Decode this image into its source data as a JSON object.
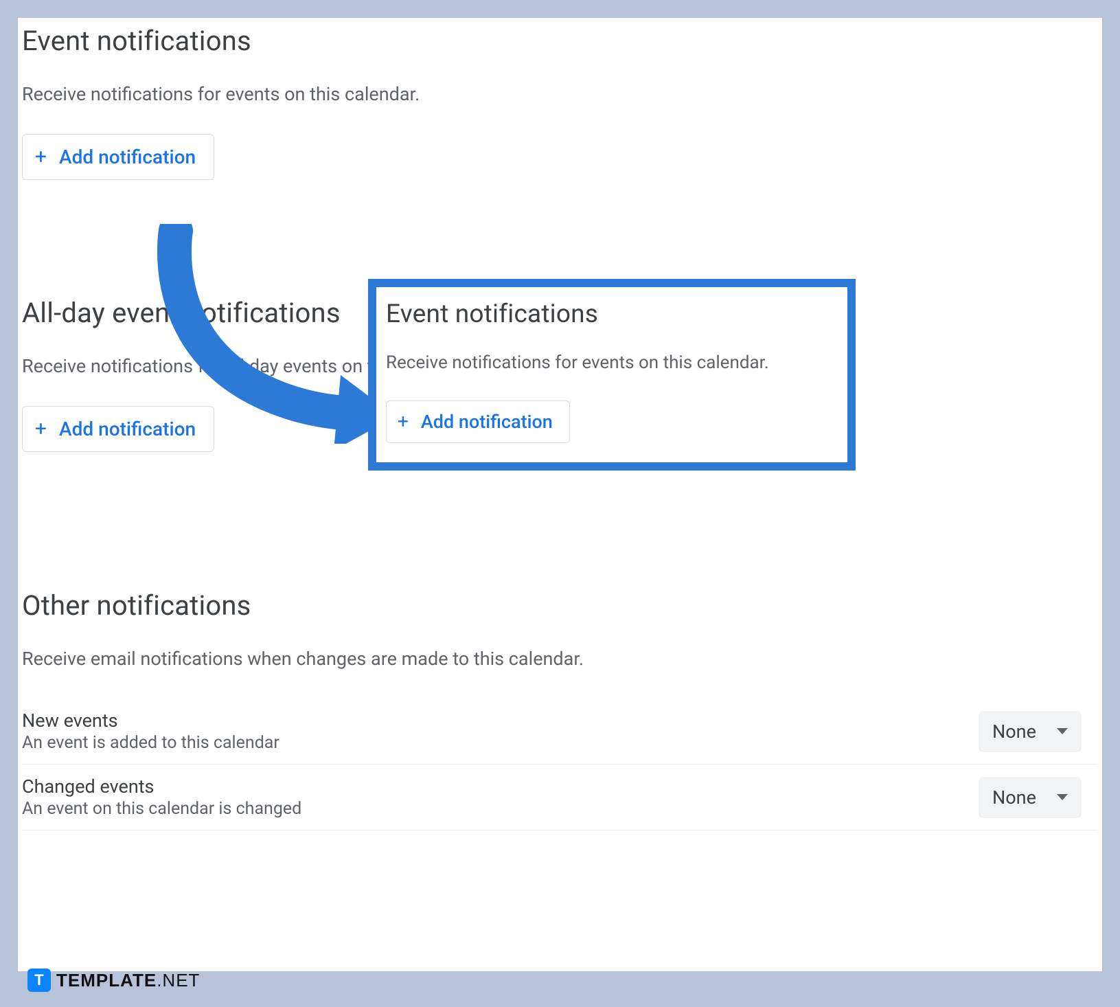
{
  "colors": {
    "accent": "#1a73e8",
    "highlight": "#2d7ad6"
  },
  "event_notifications": {
    "title": "Event notifications",
    "desc": "Receive notifications for events on this calendar.",
    "add_label": "Add notification"
  },
  "allday_notifications": {
    "title": "All-day event notifications",
    "desc": "Receive notifications for all day events on this calendar.",
    "add_label": "Add notification"
  },
  "other_notifications": {
    "title": "Other notifications",
    "desc": "Receive email notifications when changes are made to this calendar.",
    "rows": [
      {
        "title": "New events",
        "sub": "An event is added to this calendar",
        "value": "None"
      },
      {
        "title": "Changed events",
        "sub": "An event on this calendar is changed",
        "value": "None"
      }
    ]
  },
  "callout": {
    "title": "Event notifications",
    "desc": "Receive notifications for events on this calendar.",
    "add_label": "Add notification"
  },
  "watermark": {
    "bold": "TEMPLATE",
    "thin": ".NET",
    "icon_letter": "T"
  }
}
